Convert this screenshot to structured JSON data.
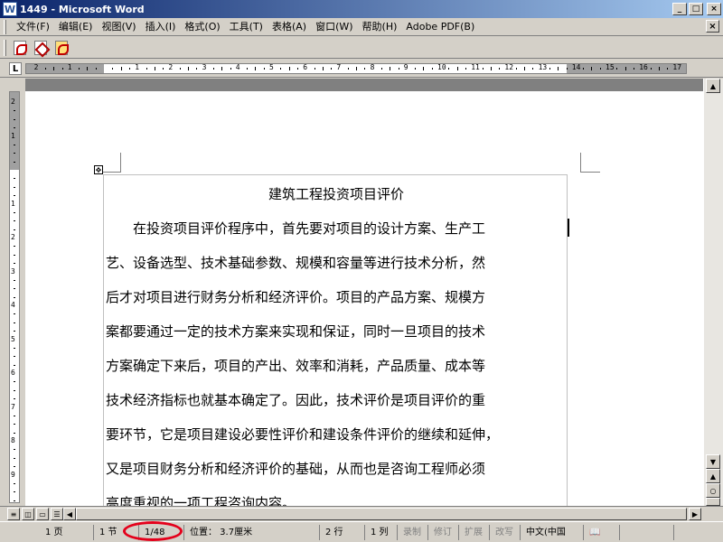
{
  "window": {
    "title": "1449 - Microsoft Word",
    "icon": "word-doc-icon",
    "buttons": [
      "_",
      "□",
      "×"
    ]
  },
  "menu": {
    "items": [
      "文件(F)",
      "编辑(E)",
      "视图(V)",
      "插入(I)",
      "格式(O)",
      "工具(T)",
      "表格(A)",
      "窗口(W)",
      "帮助(H)",
      "Adobe PDF(B)"
    ],
    "doc_close": "×"
  },
  "toolbar": {
    "icons": [
      "convert-to-pdf-icon",
      "convert-and-email-icon",
      "convert-and-review-icon"
    ]
  },
  "ruler": {
    "tab_selector": "L"
  },
  "document": {
    "title": "建筑工程投资项目评价",
    "lines": [
      "　　在投资项目评价程序中，首先要对项目的设计方案、生产工",
      "艺、设备选型、技术基础参数、规模和容量等进行技术分析，然",
      "后才对项目进行财务分析和经济评价。项目的产品方案、规模方",
      "案都要通过一定的技术方案来实现和保证，同时一旦项目的技术",
      "方案确定下来后，项目的产出、效率和消耗，产品质量、成本等",
      "技术经济指标也就基本确定了。因此，技术评价是项目评价的重",
      "要环节，它是项目建设必要性评价和建设条件评价的继续和延伸，",
      "又是项目财务分析和经济评价的基础，从而也是咨询工程师必须",
      "高度重视的一项工程咨询内容。"
    ]
  },
  "statusbar": {
    "page": "1 页",
    "section": "1 节",
    "page_of": "1/48",
    "position": "位置： 3.7厘米",
    "line": "2 行",
    "column": "1 列",
    "rec": "录制",
    "trk": "修订",
    "ext": "扩展",
    "ovr": "改写",
    "language": "中文(中国",
    "spell_icon": "spelling-check-icon"
  },
  "annotation": {
    "color": "#e4001b"
  }
}
